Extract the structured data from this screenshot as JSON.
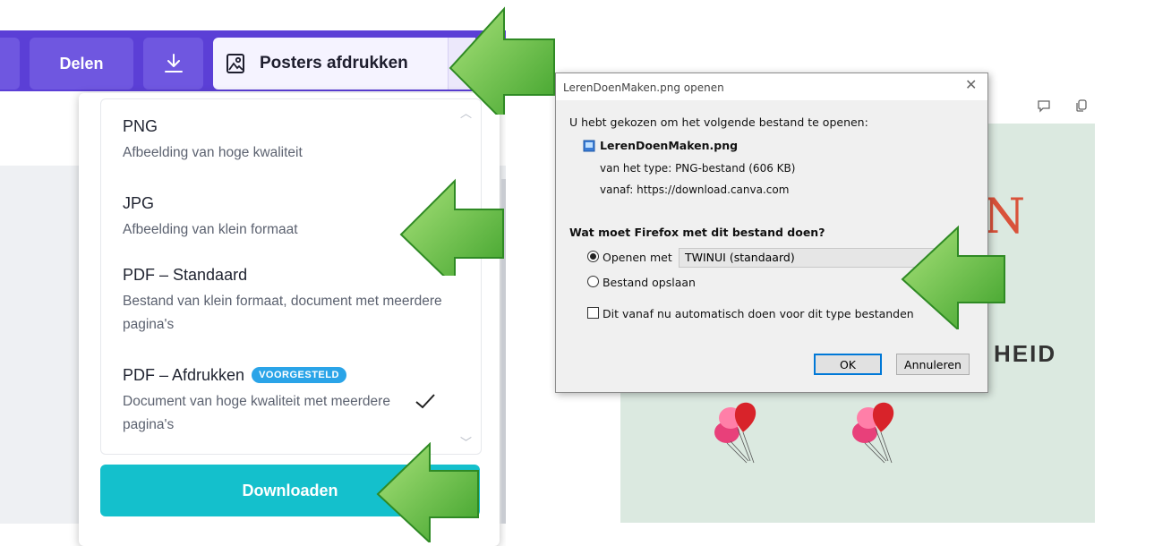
{
  "toolbar": {
    "share_label": "Delen",
    "download_icon": "download-icon",
    "posters_label": "Posters afdrukken",
    "posters_icon": "image-frame-icon"
  },
  "download_panel": {
    "options": [
      {
        "title": "PNG",
        "desc": "Afbeelding van hoge kwaliteit"
      },
      {
        "title": "JPG",
        "desc": "Afbeelding van klein formaat"
      },
      {
        "title": "PDF – Standaard",
        "desc": "Bestand van klein formaat, document met meerdere pagina's"
      },
      {
        "title": "PDF – Afdrukken",
        "badge": "VOORGESTELD",
        "desc": "Document van hoge kwaliteit met meerdere pagina's",
        "selected": true
      }
    ],
    "download_button": "Downloaden"
  },
  "dialog": {
    "title": "LerenDoenMaken.png openen",
    "intro": "U hebt gekozen om het volgende bestand te openen:",
    "filename": "LerenDoenMaken.png",
    "type_label": "van het type:",
    "type_value": "PNG-bestand (606 KB)",
    "from_label": "vanaf:",
    "from_value": "https://download.canva.com",
    "question": "Wat moet Firefox met dit bestand doen?",
    "open_with_label": "Openen met",
    "open_with_app": "TWINUI (standaard)",
    "save_label": "Bestand opslaan",
    "auto_label": "Dit vanaf nu automatisch doen voor dit type bestanden",
    "ok_label": "OK",
    "cancel_label": "Annuleren"
  },
  "poster": {
    "letter": "N",
    "word": "HEID"
  },
  "colors": {
    "canva_purple": "#5b3fd6",
    "button_purple": "#6f57e0",
    "download_teal": "#14c0cc",
    "badge_blue": "#2aa4e8",
    "arrow_green": "#5cc33a",
    "poster_bg": "#dbe9e0"
  }
}
